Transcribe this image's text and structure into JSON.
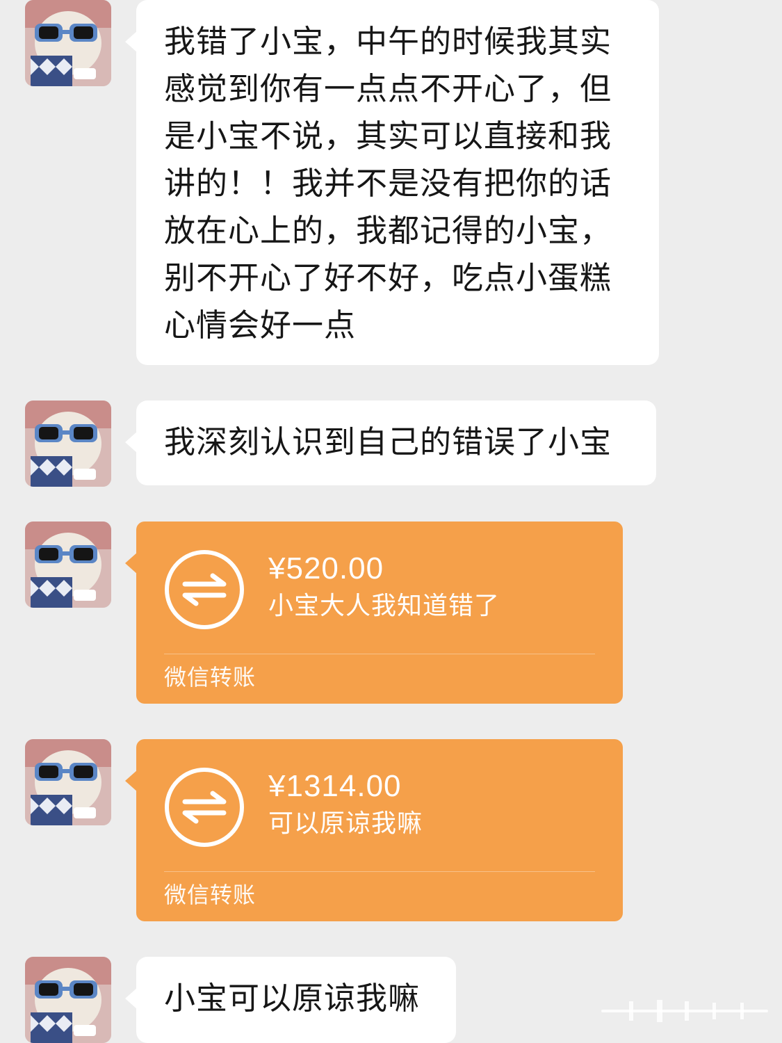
{
  "messages": [
    {
      "kind": "text",
      "text": "我错了小宝，中午的时候我其实\n感觉到你有一点点不开心了，但\n是小宝不说，其实可以直接和我\n讲的！！我并不是没有把你的话\n放在心上的，我都记得的小宝，\n别不开心了好不好，吃点小蛋糕\n心情会好一点"
    },
    {
      "kind": "text",
      "text": "我深刻认识到自己的错误了小宝"
    },
    {
      "kind": "transfer",
      "amount": "¥520.00",
      "note": "小宝大人我知道错了",
      "label": "微信转账"
    },
    {
      "kind": "transfer",
      "amount": "¥1314.00",
      "note": "可以原谅我嘛",
      "label": "微信转账"
    },
    {
      "kind": "text",
      "text": "小宝可以原谅我嘛"
    }
  ],
  "colors": {
    "background": "#ededed",
    "bubble": "#ffffff",
    "transfer": "#f5a04a"
  },
  "icons": {
    "avatar": "avatar-bear-sunglasses",
    "transfer": "transfer-arrows-icon"
  }
}
